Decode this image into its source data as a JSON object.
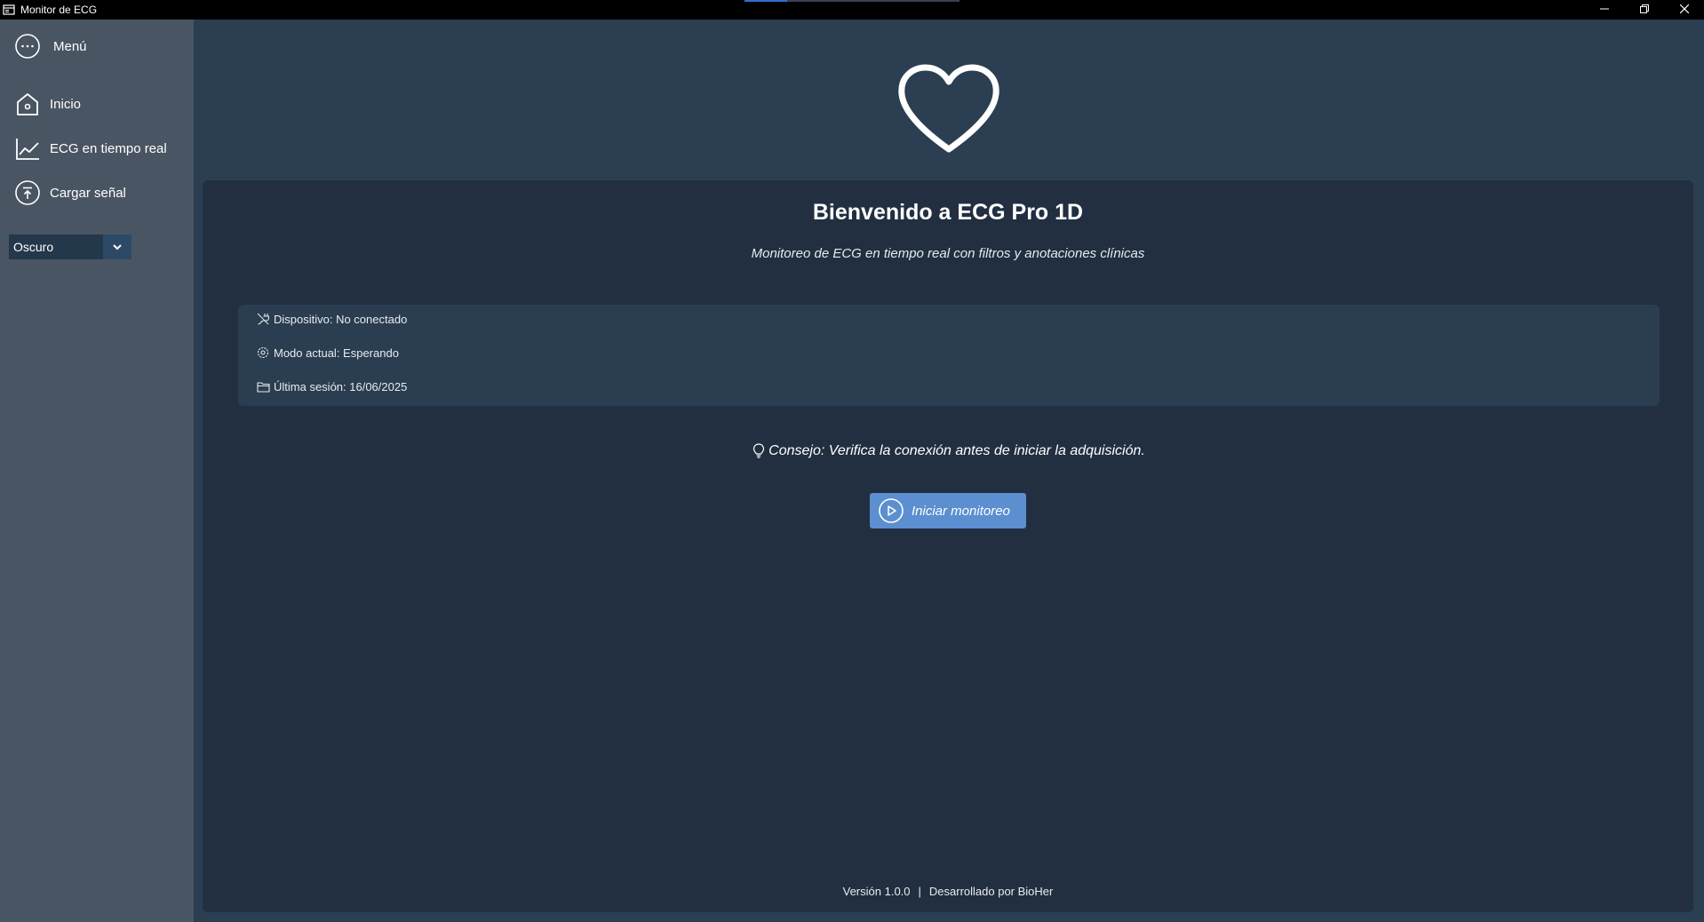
{
  "window": {
    "title": "Monitor de ECG",
    "icons": {
      "app": "app-window-icon",
      "minimize": "minimize-icon",
      "maximize": "restore-icon",
      "close": "close-icon"
    }
  },
  "sidebar": {
    "menu": {
      "label": "Menú",
      "icon": "more-horizontal-icon"
    },
    "items": [
      {
        "label": "Inicio",
        "icon": "home-icon"
      },
      {
        "label": "ECG en tiempo real",
        "icon": "line-chart-icon"
      },
      {
        "label": "Cargar señal",
        "icon": "upload-icon"
      }
    ],
    "theme": {
      "value": "Oscuro",
      "icon": "chevron-down-icon"
    }
  },
  "main": {
    "hero_icon": "heart-icon",
    "title": "Bienvenido a ECG Pro 1D",
    "subtitle": "Monitoreo de ECG en tiempo real con filtros y anotaciones clínicas",
    "status": [
      {
        "icon": "plug-icon",
        "text": "Dispositivo: No conectado"
      },
      {
        "icon": "settings-icon",
        "text": "Modo actual: Esperando"
      },
      {
        "icon": "folder-icon",
        "text": "Última sesión: 16/06/2025"
      }
    ],
    "tip": {
      "icon": "lightbulb-icon",
      "text": "Consejo: Verifica la conexión antes de iniciar la adquisición."
    },
    "start_button": {
      "label": "Iniciar monitoreo",
      "icon": "play-circle-icon"
    },
    "footer": {
      "version": "Versión 1.0.0",
      "separator": "|",
      "credit": "Desarrollado por BioHer"
    }
  },
  "colors": {
    "titlebar": "#000000",
    "sidebar": "#4a5563",
    "background": "#2b3e52",
    "card": "#212f40",
    "panel": "#2b3d50",
    "accent": "#5b8fd0"
  }
}
